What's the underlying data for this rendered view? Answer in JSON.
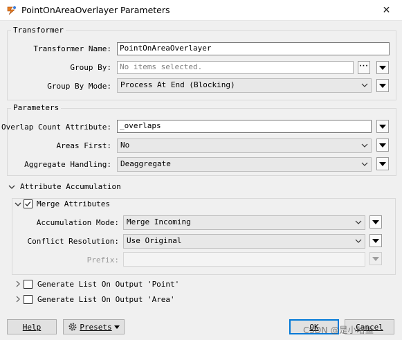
{
  "window": {
    "title": "PointOnAreaOverlayer Parameters",
    "close_glyph": "✕"
  },
  "transformer_group": {
    "title": "Transformer",
    "name_label": "Transformer Name:",
    "name_value": "PointOnAreaOverlayer",
    "group_by_label": "Group By:",
    "group_by_placeholder": "No items selected.",
    "group_by_mode_label": "Group By Mode:",
    "group_by_mode_value": "Process At End (Blocking)"
  },
  "parameters_group": {
    "title": "Parameters",
    "overlap_label": "Overlap Count Attribute:",
    "overlap_value": "_overlaps",
    "areas_first_label": "Areas First:",
    "areas_first_value": "No",
    "aggregate_label": "Aggregate Handling:",
    "aggregate_value": "Deaggregate"
  },
  "attribute_accumulation": {
    "title": "Attribute Accumulation",
    "merge_label": "Merge Attributes",
    "merge_checked": true,
    "accum_mode_label": "Accumulation Mode:",
    "accum_mode_value": "Merge Incoming",
    "conflict_label": "Conflict Resolution:",
    "conflict_value": "Use Original",
    "prefix_label": "Prefix:",
    "prefix_value": ""
  },
  "list_point": {
    "label": "Generate List On Output 'Point'",
    "checked": false
  },
  "list_area": {
    "label": "Generate List On Output 'Area'",
    "checked": false
  },
  "footer": {
    "help_label": "Help",
    "presets_label": "Presets",
    "ok_label": "OK",
    "cancel_label": "Cancel"
  },
  "watermark": "CSDN @是小哈鱼"
}
